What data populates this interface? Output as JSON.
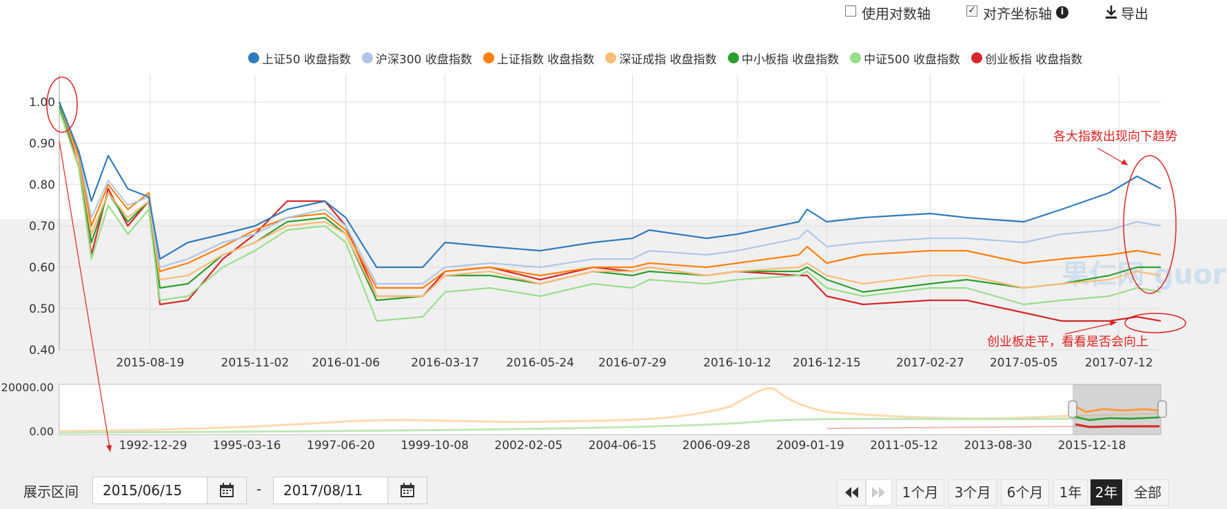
{
  "toolbar": {
    "log_axis_label": "使用对数轴",
    "log_axis_checked": false,
    "align_axis_label": "对齐坐标轴",
    "align_axis_checked": true,
    "export_label": "导出"
  },
  "chart_data": {
    "type": "line",
    "x_ticks": [
      "2015-08-19",
      "2015-11-02",
      "2016-01-06",
      "2016-03-17",
      "2016-05-24",
      "2016-07-29",
      "2016-10-12",
      "2016-12-15",
      "2017-02-27",
      "2017-05-05",
      "2017-07-12"
    ],
    "y_ticks": [
      "1.00",
      "0.90",
      "0.80",
      "0.70",
      "0.60",
      "0.50",
      "0.40"
    ],
    "ylim": [
      0.4,
      1.0
    ],
    "x_range": [
      "2015-06-15",
      "2017-08-11"
    ],
    "grid": true,
    "legend_position": "top-right",
    "series": [
      {
        "name": "上证50 收盘指数",
        "color": "#2f7bbd",
        "points": [
          [
            "2015-06-15",
            1.0
          ],
          [
            "2015-06-29",
            0.88
          ],
          [
            "2015-07-08",
            0.76
          ],
          [
            "2015-07-20",
            0.87
          ],
          [
            "2015-08-03",
            0.79
          ],
          [
            "2015-08-18",
            0.77
          ],
          [
            "2015-08-26",
            0.62
          ],
          [
            "2015-09-15",
            0.66
          ],
          [
            "2015-10-10",
            0.68
          ],
          [
            "2015-11-02",
            0.7
          ],
          [
            "2015-11-25",
            0.74
          ],
          [
            "2015-12-22",
            0.76
          ],
          [
            "2016-01-06",
            0.72
          ],
          [
            "2016-01-28",
            0.6
          ],
          [
            "2016-03-01",
            0.6
          ],
          [
            "2016-03-17",
            0.66
          ],
          [
            "2016-04-18",
            0.65
          ],
          [
            "2016-05-24",
            0.64
          ],
          [
            "2016-07-01",
            0.66
          ],
          [
            "2016-07-29",
            0.67
          ],
          [
            "2016-08-10",
            0.69
          ],
          [
            "2016-09-20",
            0.67
          ],
          [
            "2016-10-12",
            0.68
          ],
          [
            "2016-11-25",
            0.71
          ],
          [
            "2016-12-01",
            0.74
          ],
          [
            "2016-12-15",
            0.71
          ],
          [
            "2017-01-10",
            0.72
          ],
          [
            "2017-02-27",
            0.73
          ],
          [
            "2017-03-25",
            0.72
          ],
          [
            "2017-05-05",
            0.71
          ],
          [
            "2017-06-01",
            0.74
          ],
          [
            "2017-07-05",
            0.78
          ],
          [
            "2017-07-25",
            0.82
          ],
          [
            "2017-08-11",
            0.79
          ]
        ]
      },
      {
        "name": "沪深300 收盘指数",
        "color": "#aec7e8",
        "points": [
          [
            "2015-06-15",
            1.0
          ],
          [
            "2015-06-29",
            0.88
          ],
          [
            "2015-07-08",
            0.72
          ],
          [
            "2015-07-20",
            0.81
          ],
          [
            "2015-08-03",
            0.75
          ],
          [
            "2015-08-18",
            0.77
          ],
          [
            "2015-08-26",
            0.6
          ],
          [
            "2015-09-15",
            0.62
          ],
          [
            "2015-10-10",
            0.66
          ],
          [
            "2015-11-02",
            0.68
          ],
          [
            "2015-11-25",
            0.72
          ],
          [
            "2015-12-22",
            0.74
          ],
          [
            "2016-01-06",
            0.7
          ],
          [
            "2016-01-28",
            0.56
          ],
          [
            "2016-03-01",
            0.56
          ],
          [
            "2016-03-17",
            0.6
          ],
          [
            "2016-04-18",
            0.61
          ],
          [
            "2016-05-24",
            0.6
          ],
          [
            "2016-07-01",
            0.62
          ],
          [
            "2016-07-29",
            0.62
          ],
          [
            "2016-08-10",
            0.64
          ],
          [
            "2016-09-20",
            0.63
          ],
          [
            "2016-10-12",
            0.64
          ],
          [
            "2016-11-25",
            0.67
          ],
          [
            "2016-12-01",
            0.69
          ],
          [
            "2016-12-15",
            0.65
          ],
          [
            "2017-01-10",
            0.66
          ],
          [
            "2017-02-27",
            0.67
          ],
          [
            "2017-03-25",
            0.67
          ],
          [
            "2017-05-05",
            0.66
          ],
          [
            "2017-06-01",
            0.68
          ],
          [
            "2017-07-05",
            0.69
          ],
          [
            "2017-07-25",
            0.71
          ],
          [
            "2017-08-11",
            0.7
          ]
        ]
      },
      {
        "name": "上证指数 收盘指数",
        "color": "#ff7f0e",
        "points": [
          [
            "2015-06-15",
            1.0
          ],
          [
            "2015-06-29",
            0.87
          ],
          [
            "2015-07-08",
            0.7
          ],
          [
            "2015-07-20",
            0.8
          ],
          [
            "2015-08-03",
            0.74
          ],
          [
            "2015-08-18",
            0.78
          ],
          [
            "2015-08-26",
            0.59
          ],
          [
            "2015-09-15",
            0.61
          ],
          [
            "2015-10-10",
            0.65
          ],
          [
            "2015-11-02",
            0.69
          ],
          [
            "2015-11-25",
            0.72
          ],
          [
            "2015-12-22",
            0.73
          ],
          [
            "2016-01-06",
            0.69
          ],
          [
            "2016-01-28",
            0.55
          ],
          [
            "2016-03-01",
            0.55
          ],
          [
            "2016-03-17",
            0.59
          ],
          [
            "2016-04-18",
            0.6
          ],
          [
            "2016-05-24",
            0.58
          ],
          [
            "2016-07-01",
            0.6
          ],
          [
            "2016-07-29",
            0.6
          ],
          [
            "2016-08-10",
            0.61
          ],
          [
            "2016-09-20",
            0.6
          ],
          [
            "2016-10-12",
            0.61
          ],
          [
            "2016-11-25",
            0.63
          ],
          [
            "2016-12-01",
            0.65
          ],
          [
            "2016-12-15",
            0.61
          ],
          [
            "2017-01-10",
            0.63
          ],
          [
            "2017-02-27",
            0.64
          ],
          [
            "2017-03-25",
            0.64
          ],
          [
            "2017-05-05",
            0.61
          ],
          [
            "2017-06-01",
            0.62
          ],
          [
            "2017-07-05",
            0.63
          ],
          [
            "2017-07-25",
            0.64
          ],
          [
            "2017-08-11",
            0.63
          ]
        ]
      },
      {
        "name": "深证成指 收盘指数",
        "color": "#ffbb78",
        "points": [
          [
            "2015-06-15",
            1.0
          ],
          [
            "2015-06-29",
            0.86
          ],
          [
            "2015-07-08",
            0.68
          ],
          [
            "2015-07-20",
            0.78
          ],
          [
            "2015-08-03",
            0.72
          ],
          [
            "2015-08-18",
            0.76
          ],
          [
            "2015-08-26",
            0.57
          ],
          [
            "2015-09-15",
            0.58
          ],
          [
            "2015-10-10",
            0.63
          ],
          [
            "2015-11-02",
            0.66
          ],
          [
            "2015-11-25",
            0.7
          ],
          [
            "2015-12-22",
            0.71
          ],
          [
            "2016-01-06",
            0.68
          ],
          [
            "2016-01-28",
            0.53
          ],
          [
            "2016-03-01",
            0.53
          ],
          [
            "2016-03-17",
            0.58
          ],
          [
            "2016-04-18",
            0.59
          ],
          [
            "2016-05-24",
            0.56
          ],
          [
            "2016-07-01",
            0.59
          ],
          [
            "2016-07-29",
            0.59
          ],
          [
            "2016-08-10",
            0.6
          ],
          [
            "2016-09-20",
            0.58
          ],
          [
            "2016-10-12",
            0.59
          ],
          [
            "2016-11-25",
            0.6
          ],
          [
            "2016-12-01",
            0.61
          ],
          [
            "2016-12-15",
            0.58
          ],
          [
            "2017-01-10",
            0.56
          ],
          [
            "2017-02-27",
            0.58
          ],
          [
            "2017-03-25",
            0.58
          ],
          [
            "2017-05-05",
            0.55
          ],
          [
            "2017-06-01",
            0.56
          ],
          [
            "2017-07-05",
            0.57
          ],
          [
            "2017-07-25",
            0.59
          ],
          [
            "2017-08-11",
            0.58
          ]
        ]
      },
      {
        "name": "中小板指 收盘指数",
        "color": "#2ca02c",
        "points": [
          [
            "2015-06-15",
            0.99
          ],
          [
            "2015-06-29",
            0.86
          ],
          [
            "2015-07-08",
            0.66
          ],
          [
            "2015-07-20",
            0.78
          ],
          [
            "2015-08-03",
            0.71
          ],
          [
            "2015-08-18",
            0.76
          ],
          [
            "2015-08-26",
            0.55
          ],
          [
            "2015-09-15",
            0.56
          ],
          [
            "2015-10-10",
            0.63
          ],
          [
            "2015-11-02",
            0.66
          ],
          [
            "2015-11-25",
            0.71
          ],
          [
            "2015-12-22",
            0.72
          ],
          [
            "2016-01-06",
            0.68
          ],
          [
            "2016-01-28",
            0.52
          ],
          [
            "2016-03-01",
            0.53
          ],
          [
            "2016-03-17",
            0.58
          ],
          [
            "2016-04-18",
            0.58
          ],
          [
            "2016-05-24",
            0.56
          ],
          [
            "2016-07-01",
            0.59
          ],
          [
            "2016-07-29",
            0.58
          ],
          [
            "2016-08-10",
            0.59
          ],
          [
            "2016-09-20",
            0.58
          ],
          [
            "2016-10-12",
            0.59
          ],
          [
            "2016-11-25",
            0.59
          ],
          [
            "2016-12-01",
            0.6
          ],
          [
            "2016-12-15",
            0.57
          ],
          [
            "2017-01-10",
            0.54
          ],
          [
            "2017-02-27",
            0.56
          ],
          [
            "2017-03-25",
            0.57
          ],
          [
            "2017-05-05",
            0.55
          ],
          [
            "2017-06-01",
            0.56
          ],
          [
            "2017-07-05",
            0.58
          ],
          [
            "2017-07-25",
            0.6
          ],
          [
            "2017-08-11",
            0.6
          ]
        ]
      },
      {
        "name": "中证500 收盘指数",
        "color": "#98df8a",
        "points": [
          [
            "2015-06-15",
            0.98
          ],
          [
            "2015-06-29",
            0.84
          ],
          [
            "2015-07-08",
            0.62
          ],
          [
            "2015-07-20",
            0.75
          ],
          [
            "2015-08-03",
            0.68
          ],
          [
            "2015-08-18",
            0.74
          ],
          [
            "2015-08-26",
            0.52
          ],
          [
            "2015-09-15",
            0.53
          ],
          [
            "2015-10-10",
            0.6
          ],
          [
            "2015-11-02",
            0.64
          ],
          [
            "2015-11-25",
            0.69
          ],
          [
            "2015-12-22",
            0.7
          ],
          [
            "2016-01-06",
            0.66
          ],
          [
            "2016-01-28",
            0.47
          ],
          [
            "2016-03-01",
            0.48
          ],
          [
            "2016-03-17",
            0.54
          ],
          [
            "2016-04-18",
            0.55
          ],
          [
            "2016-05-24",
            0.53
          ],
          [
            "2016-07-01",
            0.56
          ],
          [
            "2016-07-29",
            0.55
          ],
          [
            "2016-08-10",
            0.57
          ],
          [
            "2016-09-20",
            0.56
          ],
          [
            "2016-10-12",
            0.57
          ],
          [
            "2016-11-25",
            0.58
          ],
          [
            "2016-12-01",
            0.59
          ],
          [
            "2016-12-15",
            0.55
          ],
          [
            "2017-01-10",
            0.53
          ],
          [
            "2017-02-27",
            0.55
          ],
          [
            "2017-03-25",
            0.55
          ],
          [
            "2017-05-05",
            0.51
          ],
          [
            "2017-06-01",
            0.52
          ],
          [
            "2017-07-05",
            0.53
          ],
          [
            "2017-07-25",
            0.55
          ],
          [
            "2017-08-11",
            0.54
          ]
        ]
      },
      {
        "name": "创业板指 收盘指数",
        "color": "#d62728",
        "points": [
          [
            "2015-06-15",
            1.0
          ],
          [
            "2015-06-29",
            0.84
          ],
          [
            "2015-07-08",
            0.63
          ],
          [
            "2015-07-20",
            0.79
          ],
          [
            "2015-08-03",
            0.7
          ],
          [
            "2015-08-18",
            0.76
          ],
          [
            "2015-08-26",
            0.51
          ],
          [
            "2015-09-15",
            0.52
          ],
          [
            "2015-10-10",
            0.62
          ],
          [
            "2015-11-02",
            0.68
          ],
          [
            "2015-11-25",
            0.76
          ],
          [
            "2015-12-22",
            0.76
          ],
          [
            "2016-01-06",
            0.7
          ],
          [
            "2016-01-28",
            0.53
          ],
          [
            "2016-03-01",
            0.53
          ],
          [
            "2016-03-17",
            0.59
          ],
          [
            "2016-04-18",
            0.6
          ],
          [
            "2016-05-24",
            0.57
          ],
          [
            "2016-07-01",
            0.6
          ],
          [
            "2016-07-29",
            0.59
          ],
          [
            "2016-08-10",
            0.6
          ],
          [
            "2016-09-20",
            0.58
          ],
          [
            "2016-10-12",
            0.59
          ],
          [
            "2016-11-25",
            0.58
          ],
          [
            "2016-12-01",
            0.58
          ],
          [
            "2016-12-15",
            0.53
          ],
          [
            "2017-01-10",
            0.51
          ],
          [
            "2017-02-27",
            0.52
          ],
          [
            "2017-03-25",
            0.52
          ],
          [
            "2017-05-05",
            0.49
          ],
          [
            "2017-06-01",
            0.47
          ],
          [
            "2017-07-05",
            0.47
          ],
          [
            "2017-07-25",
            0.48
          ],
          [
            "2017-08-11",
            0.47
          ]
        ]
      }
    ],
    "annotations": [
      {
        "text": "各大指数出现向下趋势"
      },
      {
        "text": "创业板走平，看看是否会向上"
      }
    ],
    "watermark": "果仁网 guorn.com",
    "navigator": {
      "y_ticks": [
        "20000.00",
        "0.00"
      ],
      "x_ticks": [
        "1992-12-29",
        "1995-03-16",
        "1997-06-20",
        "1999-10-08",
        "2002-02-05",
        "2004-06-15",
        "2006-09-28",
        "2009-01-19",
        "2011-05-12",
        "2013-08-30",
        "2015-12-18"
      ]
    }
  },
  "range": {
    "label": "展示区间",
    "start": "2015/06/15",
    "separator": "-",
    "end": "2017/08/11",
    "buttons": [
      "1个月",
      "3个月",
      "6个月",
      "1年",
      "2年",
      "全部"
    ],
    "active": "2年"
  }
}
